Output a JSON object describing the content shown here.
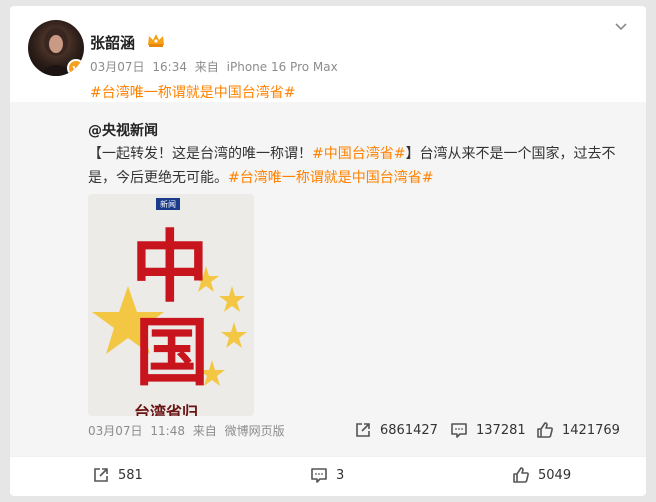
{
  "post": {
    "author": "张韶涵",
    "date": "03月07日",
    "time": "16:34",
    "source_prefix": "来自",
    "source": "iPhone 16 Pro Max",
    "text": "#台湾唯一称谓就是中国台湾省#",
    "verified_badge": "v"
  },
  "repost": {
    "author": "@央视新闻",
    "text_part1": "【一起转发！这是台湾的唯一称谓！",
    "tag1": "#中国台湾省#",
    "text_part2": "】台湾从来不是一个国家，过去不是，今后更绝无可能。",
    "tag2": "#台湾唯一称谓就是中国台湾省#",
    "image": {
      "logo_text": "新闻",
      "big_char_1": "中",
      "big_char_2": "国",
      "bottom_text": "台湾省归"
    },
    "date": "03月07日",
    "time": "11:48",
    "source_prefix": "来自",
    "source": "微博网页版",
    "reposts": "6861427",
    "comments": "137281",
    "likes": "1421769"
  },
  "footer": {
    "reposts": "581",
    "comments": "3",
    "likes": "5049"
  },
  "icons": [
    "chevron-down-icon",
    "crown-icon",
    "repost-icon",
    "comment-icon",
    "like-icon",
    "verified-icon"
  ],
  "colors": {
    "accent": "#ff8200",
    "star": "#f3c744",
    "flag_red": "#c8151d"
  }
}
